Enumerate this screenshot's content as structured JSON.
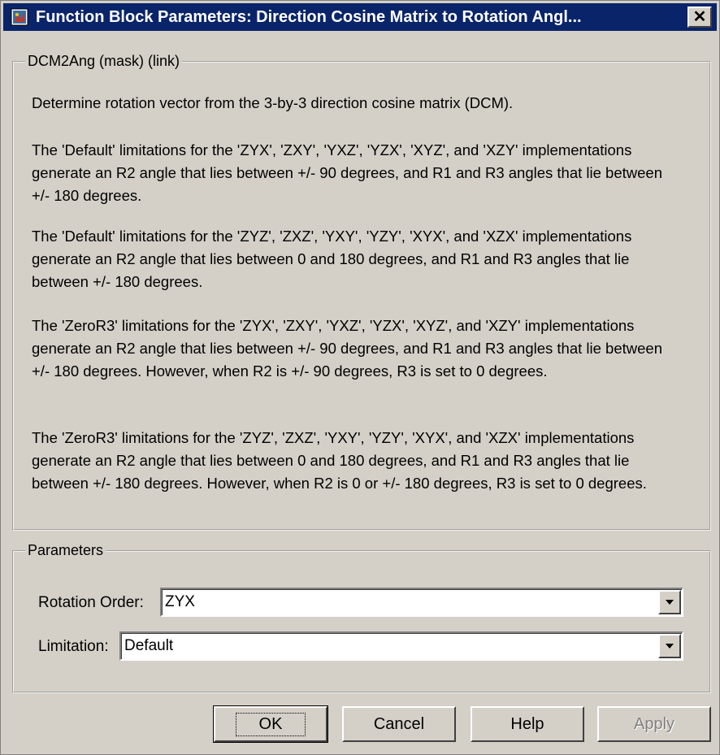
{
  "window": {
    "title": "Function Block Parameters: Direction Cosine Matrix to Rotation Angl...",
    "close_label": "✕"
  },
  "description": {
    "legend": "DCM2Ang (mask) (link)",
    "paragraphs": [
      "Determine rotation vector from the 3-by-3 direction cosine matrix (DCM).",
      "The 'Default' limitations for the 'ZYX', 'ZXY', 'YXZ', 'YZX', 'XYZ', and 'XZY' implementations generate an R2 angle that lies between +/- 90 degrees, and R1 and R3 angles that lie between +/- 180 degrees.",
      "The 'Default' limitations for the 'ZYZ', 'ZXZ', 'YXY', 'YZY', 'XYX', and 'XZX' implementations generate an R2 angle that lies between 0 and 180 degrees, and R1 and R3 angles that lie between +/- 180 degrees.",
      "The 'ZeroR3' limitations for the 'ZYX', 'ZXY', 'YXZ', 'YZX', 'XYZ', and 'XZY' implementations generate an R2 angle that lies between +/- 90 degrees, and R1 and R3 angles that lie between +/- 180 degrees. However, when R2 is +/- 90 degrees, R3 is set to 0 degrees.",
      "The 'ZeroR3' limitations for the 'ZYZ', 'ZXZ', 'YXY', 'YZY', 'XYX', and 'XZX' implementations generate an R2 angle that lies between 0 and 180 degrees, and R1 and R3 angles that lie between +/- 180 degrees. However, when R2 is 0 or +/- 180 degrees, R3 is set to 0 degrees."
    ]
  },
  "parameters": {
    "legend": "Parameters",
    "rotation_order": {
      "label": "Rotation Order:",
      "value": "ZYX"
    },
    "limitation": {
      "label": "Limitation:",
      "value": "Default"
    }
  },
  "buttons": {
    "ok": "OK",
    "cancel": "Cancel",
    "help": "Help",
    "apply": "Apply"
  },
  "colors": {
    "titlebar": "#0a246a",
    "face": "#d4d0c8"
  }
}
